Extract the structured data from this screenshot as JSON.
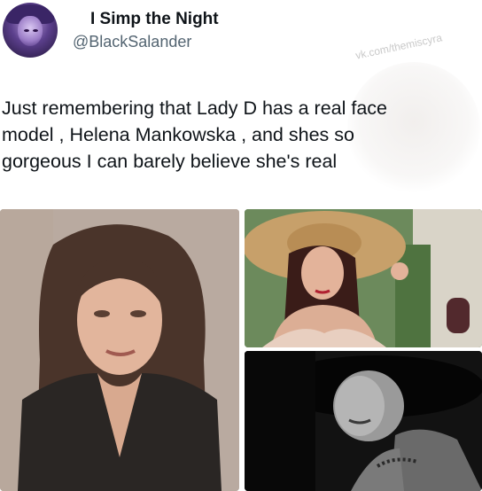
{
  "tweet": {
    "display_name": "I Simp the Night",
    "handle": "@BlackSalander",
    "text_lines": [
      "Just remembering that Lady D has a real face",
      "model , Helena Mankowska , and shes so",
      "gorgeous I can barely believe she's real"
    ],
    "watermark": "vk.com/themiscyra"
  },
  "icons": {
    "left_moon": "crescent-moon-icon",
    "right_moon": "crescent-moon-icon"
  },
  "colors": {
    "name": "#0f1419",
    "handle": "#536471",
    "moon": "#f2c94c"
  }
}
